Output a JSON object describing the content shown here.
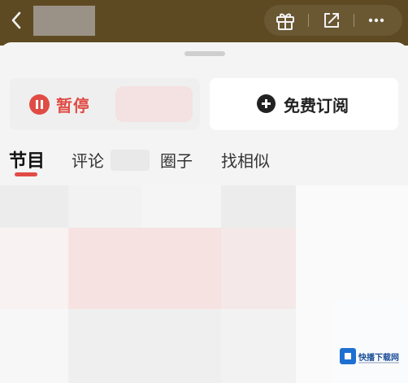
{
  "header": {
    "back_icon": "chevron-left-icon",
    "actions": [
      {
        "icon": "gift-icon"
      },
      {
        "icon": "share-icon"
      },
      {
        "icon": "more-icon"
      }
    ]
  },
  "player": {
    "pause_label": "暂停",
    "subscribe_label": "免费订阅",
    "accent_color": "#e04c45"
  },
  "tabs": [
    {
      "label": "节目",
      "active": true
    },
    {
      "label": "评论",
      "active": false
    },
    {
      "label": "圈子",
      "active": false
    },
    {
      "label": "找相似",
      "active": false
    }
  ],
  "watermark": {
    "text": "快播下载网"
  }
}
